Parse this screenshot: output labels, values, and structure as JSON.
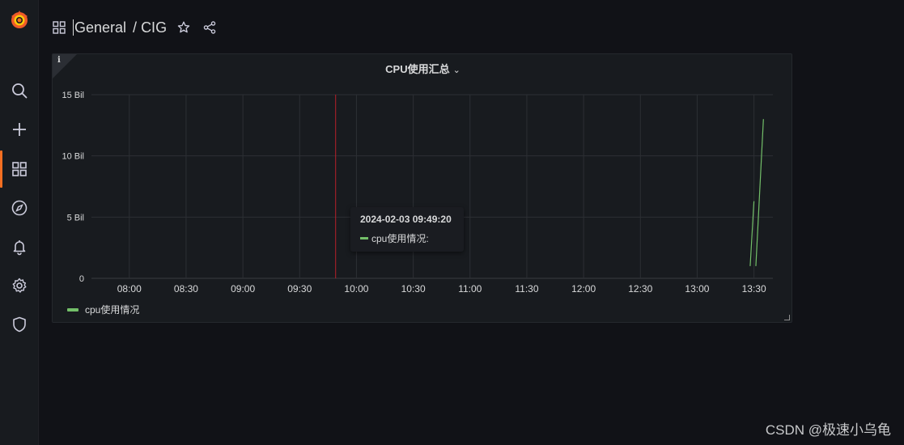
{
  "sidebar": {
    "items": [
      {
        "name": "search"
      },
      {
        "name": "create"
      },
      {
        "name": "dashboards",
        "active": true
      },
      {
        "name": "explore"
      },
      {
        "name": "alerting"
      },
      {
        "name": "configuration"
      },
      {
        "name": "server-admin"
      }
    ]
  },
  "breadcrumb": {
    "folder": "General",
    "separator": "/",
    "dashboard": "CIG"
  },
  "panel": {
    "title": "CPU使用汇总",
    "info_icon": "i",
    "legend": [
      {
        "label": "cpu使用情况",
        "color": "#73bf69"
      }
    ]
  },
  "tooltip": {
    "time": "2024-02-03 09:49:20",
    "series_label": "cpu使用情况:"
  },
  "chart_data": {
    "type": "line",
    "title": "CPU使用汇总",
    "y_ticks": [
      "0",
      "5 Bil",
      "10 Bil",
      "15 Bil"
    ],
    "ylim": [
      0,
      15000000000
    ],
    "x_ticks": [
      "08:00",
      "08:30",
      "09:00",
      "09:30",
      "10:00",
      "10:30",
      "11:00",
      "11:30",
      "12:00",
      "12:30",
      "13:00",
      "13:30"
    ],
    "xlim": [
      "07:40",
      "13:40"
    ],
    "cursor_time": "09:49",
    "series": [
      {
        "name": "cpu使用情况",
        "color": "#73bf69",
        "segments": [
          [
            [
              "13:28",
              1000000000
            ],
            [
              "13:30",
              6300000000
            ]
          ],
          [
            [
              "13:31",
              1000000000
            ],
            [
              "13:35",
              13000000000
            ]
          ]
        ]
      }
    ]
  },
  "watermark": "CSDN @极速小乌龟",
  "colors": {
    "background": "#111217",
    "panel": "#181b1f",
    "accent": "#f46f22",
    "series": "#73bf69",
    "cursor": "#b8202a"
  }
}
